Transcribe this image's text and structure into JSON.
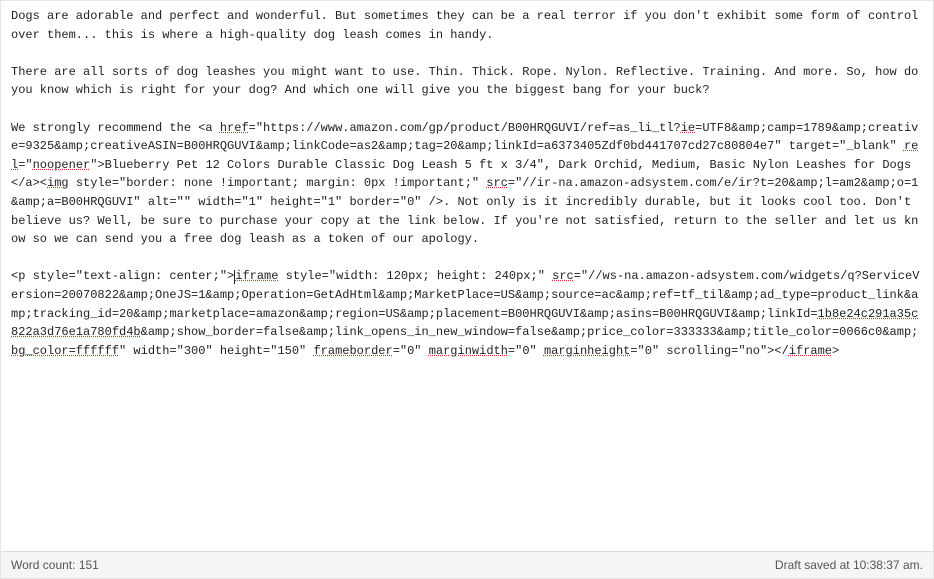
{
  "editor": {
    "para1": "Dogs are adorable and perfect and wonderful. But sometimes they can be a real terror if you don't exhibit some form of control over them... this is where a high-quality dog leash comes in handy.",
    "para2": "There are all sorts of dog leashes you might want to use. Thin. Thick. Rope. Nylon. Reflective. Training. And more. So, how do you know which is right for your dog? And which one will give you the biggest bang for your buck?",
    "para3_pre": "We strongly recommend the <a ",
    "para3_href_attr": "href",
    "para3_href_val": "=\"https://www.amazon.com/gp/product/B00HRQGUVI/ref=as_li_tl?",
    "para3_q_ie": "ie",
    "para3_q_rest1": "=UTF8&amp;camp=1789&amp;creative=9325&amp;creativeASIN=B00HRQGUVI&amp;linkCode=as2&amp;tag=",
    "para3_q_rest2": "20&amp;linkId=a6373405Zdf0bd441707cd27c80804e7\" target=\"_blank\" ",
    "para3_rel": "rel",
    "para3_rest3": "=\"",
    "para3_noopener": "noopener",
    "para3_rest4": "\">Blueberry Pet 12 Colors Durable Classic Dog Leash 5 ft x 3/4\", Dark Orchid, Medium, Basic Nylon Leashes for Dogs</a><",
    "para3_img": "img",
    "para3_rest5": " style=\"border: none !important; margin: 0px !important;\" ",
    "para3_src": "src",
    "para3_rest6": "=\"//ir-na.amazon-adsystem.com/e/ir?t=",
    "para3_rest7": "20&amp;l=am2&amp;o=1&amp;a=B00HRQGUVI\" alt=\"\" width=\"1\" height=\"1\" border=\"0\" />. Not only is it incredibly durable, but it looks cool too. Don't believe us? Well, be sure to purchase your copy at the link below. If you're not satisfied, return to the seller and let us know so we can send you a free dog leash as a token of our apology.",
    "para4_a": "<p style=\"text-align: center;\">",
    "para4_b": "iframe",
    "para4_c": " style=\"width: 120px; height: 240px;\" ",
    "para4_src": "src",
    "para4_d": "=\"//ws-na.amazon-adsystem.com/widgets/q?",
    "para4_e": "ServiceVersion=20070822&amp;OneJS=1&amp;Operation=GetAdHtml&amp;MarketPlace=US&amp;source=ac&amp;ref=tf_til&amp;ad_type=product_link&amp;tracking_id=",
    "para4_f": "20&amp;marketplace=amazon&amp;region=US&amp;placement=B00HRQGUVI&amp;asins=B00HRQGUVI&amp;linkId=",
    "para4_linkid": "1b8e24c291a35c822a3d76e1a780fd4b",
    "para4_g": "&amp;show_border=false&amp;link_opens_in_new_window=false&amp;price_color=333333&amp;title_color=0066c0&amp;",
    "para4_bg": "bg_color=ffffff",
    "para4_h": "\" width=\"300\" height=\"150\" ",
    "para4_fb": "frameborder",
    "para4_i": "=\"0\" ",
    "para4_mw": "marginwidth",
    "para4_j": "=\"0\" ",
    "para4_mh": "marginheight",
    "para4_k": "=\"0\" scrolling=\"no\"></",
    "para4_l": "iframe",
    "para4_m": ">"
  },
  "status": {
    "wordcount_label": "Word count: ",
    "wordcount_value": "151",
    "draft_saved": "Draft saved at 10:38:37 am."
  }
}
